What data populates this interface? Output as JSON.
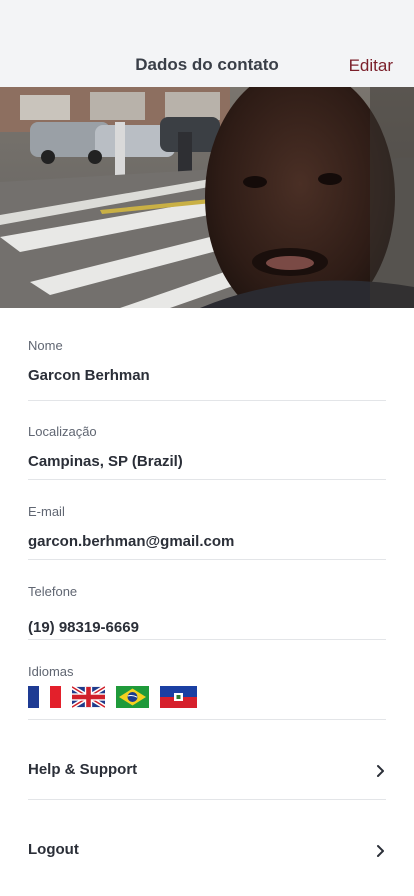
{
  "header": {
    "title": "Dados do contato",
    "edit_label": "Editar"
  },
  "fields": {
    "name": {
      "label": "Nome",
      "value": "Garcon Berhman"
    },
    "location": {
      "label": "Localização",
      "value": "Campinas, SP (Brazil)"
    },
    "email": {
      "label": "E-mail",
      "value": "garcon.berhman@gmail.com"
    },
    "phone": {
      "label": "Telefone",
      "value": "(19) 98319-6669"
    },
    "languages": {
      "label": "Idiomas",
      "flags": [
        "france-flag-icon",
        "uk-flag-icon",
        "brazil-flag-icon",
        "haiti-flag-icon"
      ]
    }
  },
  "menu": [
    {
      "label": "Help & Support",
      "icon": "chevron-right-icon"
    },
    {
      "label": "Logout",
      "icon": "chevron-right-icon"
    }
  ],
  "colors": {
    "header_bg": "#f3f4f6",
    "accent": "#7b1f2a",
    "divider": "#e3e5e8"
  }
}
